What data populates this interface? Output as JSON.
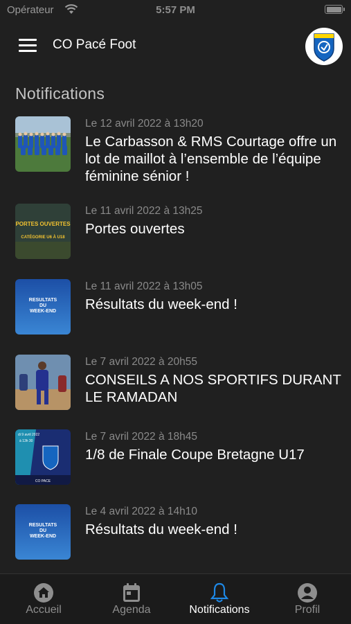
{
  "status_bar": {
    "carrier": "Opérateur",
    "time": "5:57 PM"
  },
  "header": {
    "title": "CO Pacé Foot"
  },
  "section": {
    "title": "Notifications"
  },
  "notifications": [
    {
      "date": "Le 12 avril 2022 à 13h20",
      "title": "Le Carbasson & RMS Courtage offre un lot de maillot à l’ensemble de l’équipe féminine sénior !"
    },
    {
      "date": "Le 11 avril 2022 à 13h25",
      "title": "Portes ouvertes",
      "thumb": {
        "line1": "PORTES OUVERTES",
        "line2": "CATÉGORIE U6 À U18"
      }
    },
    {
      "date": "Le 11 avril 2022 à 13h05",
      "title": "Résultats du week-end !",
      "thumb": {
        "line1": "RESULTATS",
        "line2": "DU",
        "line3": "WEEK-END"
      }
    },
    {
      "date": "Le 7 avril 2022 à 20h55",
      "title": "CONSEILS A NOS SPORTIFS DURANT LE RAMADAN"
    },
    {
      "date": "Le 7 avril 2022 à 18h45",
      "title": "1/8 de Finale Coupe Bretagne U17",
      "thumb": {
        "line1": "di 9 avril 2022",
        "line2": "à 13h 30",
        "line3": "CO PACE"
      }
    },
    {
      "date": "Le 4 avril 2022 à 14h10",
      "title": "Résultats du week-end !",
      "thumb": {
        "line1": "RESULTATS",
        "line2": "DU",
        "line3": "WEEK-END"
      }
    }
  ],
  "tabs": [
    {
      "label": "Accueil",
      "icon": "home-icon",
      "active": false
    },
    {
      "label": "Agenda",
      "icon": "calendar-icon",
      "active": false
    },
    {
      "label": "Notifications",
      "icon": "bell-icon",
      "active": true
    },
    {
      "label": "Profil",
      "icon": "profile-icon",
      "active": false
    }
  ],
  "colors": {
    "background": "#202020",
    "accent": "#1e88e5",
    "tab_inactive": "#8e8e8e"
  }
}
